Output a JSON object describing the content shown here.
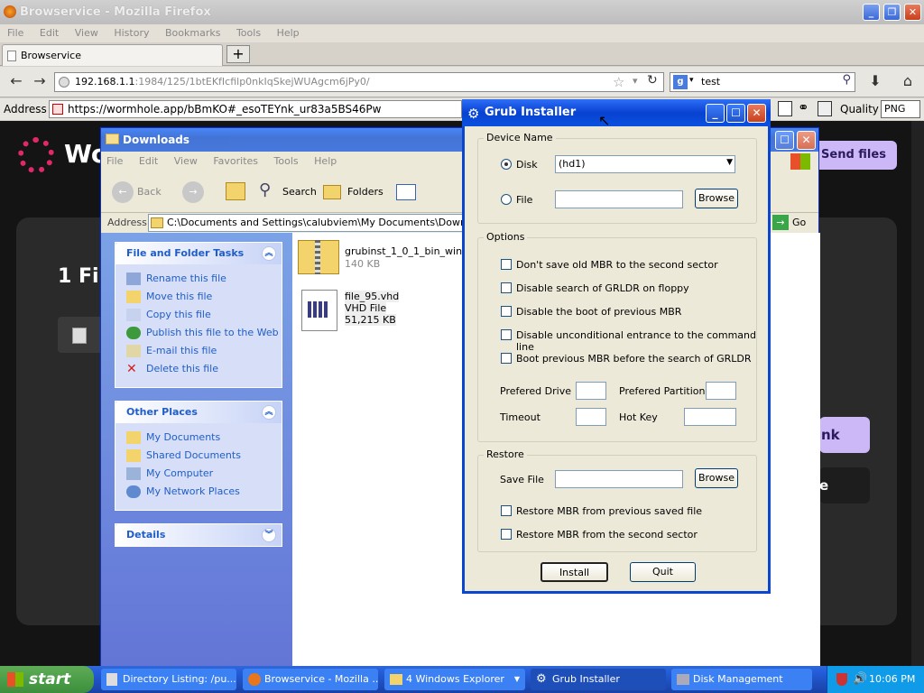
{
  "firefox": {
    "title": "Browservice - Mozilla Firefox",
    "menu": [
      "File",
      "Edit",
      "View",
      "History",
      "Bookmarks",
      "Tools",
      "Help"
    ],
    "tab_label": "Browservice",
    "url_host": "192.168.1.1",
    "url_rest": ":1984/125/1btEKfIcfilp0nkIqSkejWUAgcm6jPy0/",
    "search_value": "test"
  },
  "inner_toolbar": {
    "address_label": "Address",
    "address_value": "https://wormhole.app/bBmKO#_esoTEYnk_ur83a5BS46Pw",
    "quality_label": "Quality",
    "quality_value": "PNG"
  },
  "webpage": {
    "logo_text": "Wo",
    "send_files": "Send files",
    "heading": "1 Fil",
    "btn_partial1": "nk",
    "btn_partial2": "e"
  },
  "explorer": {
    "title": "Downloads",
    "menu": [
      "File",
      "Edit",
      "View",
      "Favorites",
      "Tools",
      "Help"
    ],
    "back_label": "Back",
    "search_label": "Search",
    "folders_label": "Folders",
    "address_label": "Address",
    "address_value": "C:\\Documents and Settings\\calubviem\\My Documents\\Downloads",
    "go_label": "Go",
    "file_tasks_title": "File and Folder Tasks",
    "file_tasks": [
      "Rename this file",
      "Move this file",
      "Copy this file",
      "Publish this file to the Web",
      "E-mail this file",
      "Delete this file"
    ],
    "other_places_title": "Other Places",
    "other_places": [
      "My Documents",
      "Shared Documents",
      "My Computer",
      "My Network Places"
    ],
    "details_title": "Details",
    "files": [
      {
        "name": "grubinst_1_0_1_bin_win",
        "line2": "140 KB",
        "line3": ""
      },
      {
        "name": "file_95.vhd",
        "line2": "VHD File",
        "line3": "51,215 KB"
      }
    ]
  },
  "grub": {
    "title": "Grub Installer",
    "device_group": "Device Name",
    "disk_label": "Disk",
    "disk_value": "(hd1)",
    "file_label": "File",
    "browse": "Browse",
    "options_group": "Options",
    "options": [
      "Don't save old MBR to the second sector",
      "Disable search of GRLDR on floppy",
      "Disable the boot of previous MBR",
      "Disable unconditional entrance to the command line",
      "Boot previous MBR before the search of GRLDR"
    ],
    "prefered_drive": "Prefered Drive",
    "prefered_partition": "Prefered Partition",
    "timeout": "Timeout",
    "hot_key": "Hot Key",
    "restore_group": "Restore",
    "save_file": "Save File",
    "restore_options": [
      "Restore MBR from previous saved file",
      "Restore MBR from the second sector"
    ],
    "install": "Install",
    "quit": "Quit"
  },
  "taskbar": {
    "start": "start",
    "items": [
      "Directory Listing: /pu...",
      "Browservice - Mozilla ...",
      "4 Windows Explorer",
      "Grub Installer",
      "Disk Management"
    ],
    "clock": "10:06 PM"
  }
}
